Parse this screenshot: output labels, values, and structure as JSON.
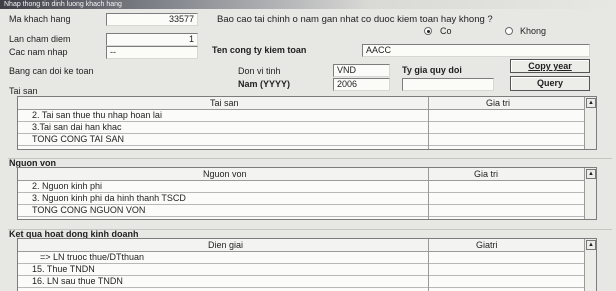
{
  "window": {
    "title": "Nhap thong tin dinh luong khach hang"
  },
  "form": {
    "ma_khach_hang_label": "Ma khach hang",
    "ma_khach_hang_value": "33577",
    "lan_cham_diem_label": "Lan cham diem",
    "lan_cham_diem_value": "1",
    "cac_nam_nhap_label": "Cac nam nhap",
    "cac_nam_nhap_value": "--",
    "bao_cao_question": "Bao cao tai chinh o nam gan nhat co duoc kiem toan hay khong ?",
    "radio_co": "Co",
    "radio_khong": "Khong",
    "ten_cong_ty_label": "Ten cong ty kiem toan",
    "ten_cong_ty_value": "AACC",
    "bang_can_doi_label": "Bang can doi ke toan",
    "don_vi_tinh_label": "Don vi tinh",
    "don_vi_tinh_value": "VND",
    "ty_gia_label": "Ty gia quy doi",
    "ty_gia_value": "",
    "nam_label": "Nam (YYYY)",
    "nam_value": "2006",
    "copy_year_button": "Copy year",
    "query_button": "Query",
    "tai_san_label": "Tai san"
  },
  "tai_san_grid": {
    "col_desc": "Tai san",
    "col_value": "Gia tri",
    "rows": [
      "2. Tai san thue thu nhap hoan lai",
      "3.Tai san dai han khac",
      "TONG CONG TAI SAN"
    ]
  },
  "nguon_von": {
    "section_label": "Nguon von",
    "col_desc": "Nguon von",
    "col_value": "Gia tri",
    "rows": [
      "2. Nguon kinh phi",
      "3. Nguon kinh phi da hinh thanh TSCD",
      "TONG CONG NGUON VON"
    ]
  },
  "kqkd": {
    "section_label": "Ket qua hoat dong kinh doanh",
    "col_desc": "Dien giai",
    "col_value": "Giatri",
    "rows": [
      "=> LN truoc thue/DTthuan",
      "15. Thue TNDN",
      "16. LN sau thue TNDN"
    ]
  }
}
